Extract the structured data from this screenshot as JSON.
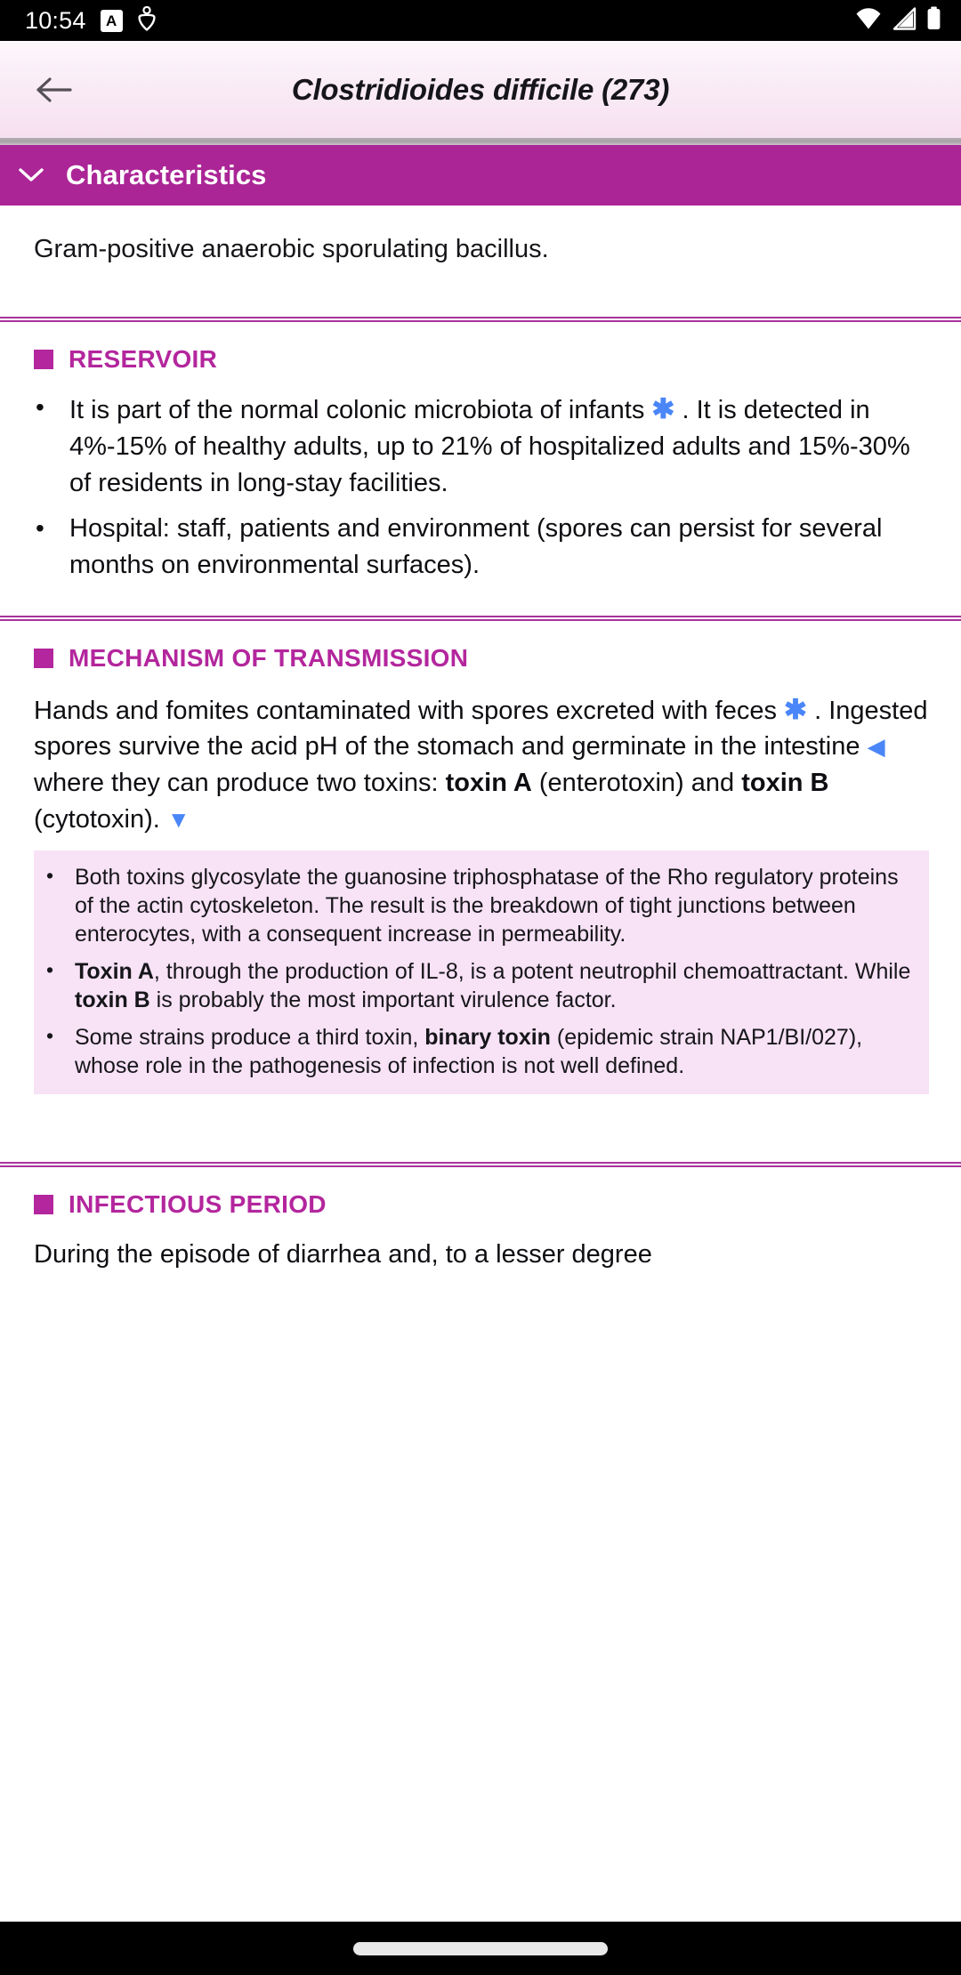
{
  "status_bar": {
    "time": "10:54",
    "icon_a_label": "A",
    "icons": [
      "a-box-icon",
      "accessibility-icon",
      "wifi-icon",
      "signal-icon",
      "battery-icon"
    ]
  },
  "header": {
    "back_label": "Back",
    "title": "Clostridioides difficile (273)"
  },
  "section_bar": {
    "title": "Characteristics",
    "chevron": "chevron-down-icon"
  },
  "content": {
    "intro": "Gram-positive anaerobic sporulating bacillus.",
    "sections": [
      {
        "heading": "RESERVOIR",
        "bullets": [
          {
            "parts": [
              {
                "t": "It is part of the normal colonic microbiota of infants ",
                "s": "normal"
              },
              {
                "t": "✱",
                "s": "asterisk"
              },
              {
                "t": " . It is detected in 4%-15% of healthy adults, up to 21% of hospitalized adults and 15%-30% of residents in long-stay facilities.",
                "s": "normal"
              }
            ]
          },
          {
            "parts": [
              {
                "t": "Hospital: staff, patients and environment (spores can persist for several months on environmental surfaces).",
                "s": "normal"
              }
            ]
          }
        ]
      },
      {
        "heading": "MECHANISM OF TRANSMISSION",
        "paragraph_parts": [
          {
            "t": "Hands and fomites contaminated with spores excreted with feces ",
            "s": "normal"
          },
          {
            "t": "✱",
            "s": "asterisk"
          },
          {
            "t": " . Ingested spores survive the acid pH of the stomach and germinate in the intestine ",
            "s": "normal"
          },
          {
            "t": "◀",
            "s": "tri-left"
          },
          {
            "t": " where they can produce two toxins: ",
            "s": "normal"
          },
          {
            "t": "toxin A",
            "s": "bold"
          },
          {
            "t": " (enterotoxin) and ",
            "s": "normal"
          },
          {
            "t": "toxin B",
            "s": "bold"
          },
          {
            "t": " (cytotoxin). ",
            "s": "normal"
          },
          {
            "t": "▼",
            "s": "tri-down"
          }
        ],
        "note_box": [
          {
            "parts": [
              {
                "t": "Both toxins glycosylate the guanosine triphosphatase of the Rho regulatory proteins of the actin cytoskeleton. The result is the breakdown of tight junctions between enterocytes, with a consequent increase in permeability.",
                "s": "normal"
              }
            ]
          },
          {
            "parts": [
              {
                "t": "Toxin A",
                "s": "bold"
              },
              {
                "t": ", through the production of IL-8, is a potent neutrophil chemoattractant. While ",
                "s": "normal"
              },
              {
                "t": "toxin B",
                "s": "bold"
              },
              {
                "t": " is probably the most important virulence factor.",
                "s": "normal"
              }
            ]
          },
          {
            "parts": [
              {
                "t": "Some strains produce a third toxin, ",
                "s": "normal"
              },
              {
                "t": "binary toxin",
                "s": "bold"
              },
              {
                "t": " (epidemic strain NAP1/BI/027), whose role in the pathogenesis of infection is not well defined.",
                "s": "normal"
              }
            ]
          }
        ]
      },
      {
        "heading": "INFECTIOUS PERIOD",
        "paragraph_parts": [
          {
            "t": "During the episode of diarrhea and, to a lesser degree",
            "s": "normal"
          }
        ]
      }
    ]
  },
  "colors": {
    "accent_magenta": "#b3269d",
    "section_bar_bg": "#ab2596",
    "note_box_bg": "#f8e2f6",
    "marker_blue": "#4a86f7",
    "header_gradient_top": "#fdf7fb",
    "header_gradient_bottom": "#f6e0f0"
  },
  "nav_bar": {
    "handle": "home-handle"
  }
}
